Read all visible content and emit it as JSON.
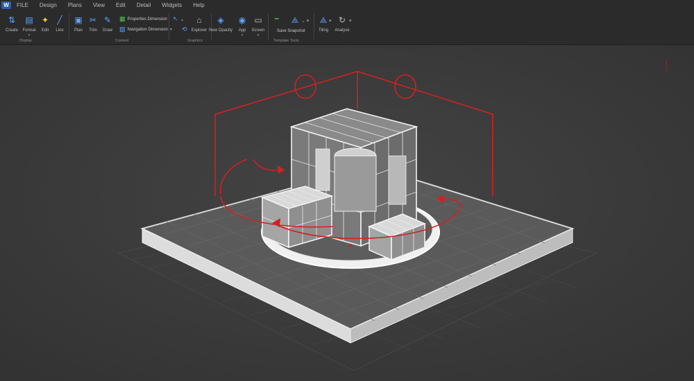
{
  "app": {
    "logo": "W"
  },
  "tabs": [
    "FILE",
    "Design",
    "Plans",
    "View",
    "Edit",
    "Detail",
    "Widgets",
    "Help"
  ],
  "toolbar": {
    "tools": [
      {
        "id": "create",
        "label": "Create",
        "icon": "cursor-select-icon",
        "glyph": "⇅",
        "color": "#5ba3ff"
      },
      {
        "id": "format",
        "label": "Format",
        "icon": "grid-table-icon",
        "glyph": "▤",
        "color": "#5ba3ff"
      },
      {
        "id": "edit",
        "label": "Edit",
        "icon": "magic-wand-icon",
        "glyph": "✦",
        "color": "#ffcc33"
      },
      {
        "id": "line",
        "label": "Line",
        "icon": "pen-line-icon",
        "glyph": "╱",
        "color": "#5ba3ff"
      },
      {
        "id": "plan",
        "label": "Plan",
        "icon": "plan-view-icon",
        "glyph": "▣",
        "color": "#5ba3ff"
      },
      {
        "id": "trim",
        "label": "Trim",
        "icon": "trim-icon",
        "glyph": "✂",
        "color": "#5ba3ff"
      },
      {
        "id": "draw",
        "label": "Draw",
        "icon": "draw-icon",
        "glyph": "✎",
        "color": "#5ba3ff"
      },
      {
        "id": "explorer",
        "label": "Explorer",
        "icon": "home-icon",
        "glyph": "⌂",
        "color": "#bdbdbd"
      },
      {
        "id": "new-opacity",
        "label": "New Opacity",
        "icon": "cube-icon",
        "glyph": "◈",
        "color": "#5ba3ff"
      },
      {
        "id": "app",
        "label": "App",
        "icon": "globe-icon",
        "glyph": "◉",
        "color": "#5ba3ff"
      },
      {
        "id": "screen",
        "label": "Screen",
        "icon": "monitor-icon",
        "glyph": "▭",
        "color": "#bdbdbd"
      },
      {
        "id": "tiling",
        "label": "Tiling",
        "icon": "node-link-icon",
        "glyph": "⟁",
        "color": "#5ba3ff"
      },
      {
        "id": "analyse",
        "label": "Analyse",
        "icon": "refresh-icon",
        "glyph": "↻",
        "color": "#bdbdbd"
      }
    ],
    "row_items": [
      {
        "id": "properties",
        "label": "Properties Dimension",
        "icon": "properties-icon",
        "glyph": "▦",
        "color": "#4fc34f"
      },
      {
        "id": "navigation",
        "label": "Navigation Dimension",
        "icon": "navigation-icon",
        "glyph": "▧",
        "color": "#5ba3ff"
      },
      {
        "id": "save-snapshot",
        "label": "Save Snapshot",
        "icon": "snapshot-line-icon",
        "glyph": "━",
        "color": "#4fc34f"
      }
    ],
    "small": [
      {
        "id": "arrow-icon",
        "glyph": "↖",
        "color": "#5ba3ff"
      },
      {
        "id": "chevron-icon",
        "glyph": "⌄",
        "color": "#bdbdbd"
      },
      {
        "id": "rotate-icon",
        "glyph": "⟲",
        "color": "#5ba3ff"
      }
    ],
    "groups": [
      "Display",
      "Content",
      "Graphics",
      "Template Tools"
    ]
  },
  "colors": {
    "ribbon": "#2b2b2b",
    "viewport": "#3b3b3b",
    "gizmo": "#d42020",
    "model": "#e8e8e8"
  }
}
